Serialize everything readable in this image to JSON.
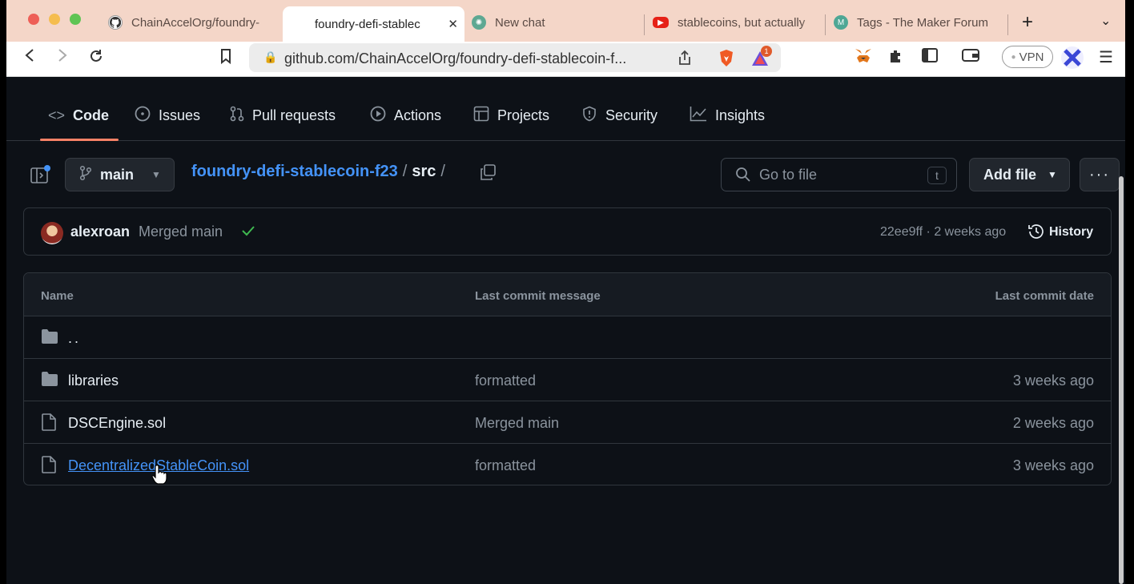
{
  "browser": {
    "tabs": [
      {
        "label": "ChainAccelOrg/foundry-",
        "icon": "github-icon"
      },
      {
        "label": "foundry-defi-stablec",
        "icon": "blank",
        "active": true
      },
      {
        "label": "New chat",
        "icon": "chatgpt-icon"
      },
      {
        "label": "stablecoins, but actually",
        "icon": "youtube-icon"
      },
      {
        "label": "Tags - The Maker Forum",
        "icon": "maker-icon"
      }
    ],
    "url": "github.com/ChainAccelOrg/foundry-defi-stablecoin-f...",
    "brave_badge": "1",
    "vpn_label": "VPN"
  },
  "repo_nav": {
    "items": [
      {
        "label": "Code",
        "icon": "code-icon"
      },
      {
        "label": "Issues",
        "icon": "issue-icon"
      },
      {
        "label": "Pull requests",
        "icon": "pull-request-icon"
      },
      {
        "label": "Actions",
        "icon": "play-icon"
      },
      {
        "label": "Projects",
        "icon": "table-icon"
      },
      {
        "label": "Security",
        "icon": "shield-icon"
      },
      {
        "label": "Insights",
        "icon": "graph-icon"
      }
    ]
  },
  "filebar": {
    "branch": "main",
    "repo": "foundry-defi-stablecoin-f23",
    "folder": "src",
    "go_to_file_placeholder": "Go to file",
    "go_to_file_key": "t",
    "add_file": "Add file"
  },
  "commit": {
    "author": "alexroan",
    "message": "Merged main",
    "meta": "22ee9ff · 2 weeks ago",
    "history": "History"
  },
  "table": {
    "headers": [
      "Name",
      "Last commit message",
      "Last commit date"
    ],
    "rows": [
      {
        "name": "..",
        "type": "folder",
        "message": "",
        "date": ""
      },
      {
        "name": "libraries",
        "type": "folder",
        "message": "formatted",
        "date": "3 weeks ago"
      },
      {
        "name": "DSCEngine.sol",
        "type": "file",
        "message": "Merged main",
        "date": "2 weeks ago"
      },
      {
        "name": "DecentralizedStableCoin.sol",
        "type": "file",
        "message": "formatted",
        "date": "3 weeks ago",
        "hover": true
      }
    ]
  },
  "colors": {
    "background": "#0d1117",
    "link": "#4493f8",
    "tab_accent": "#f78166",
    "check": "#3fb950"
  }
}
